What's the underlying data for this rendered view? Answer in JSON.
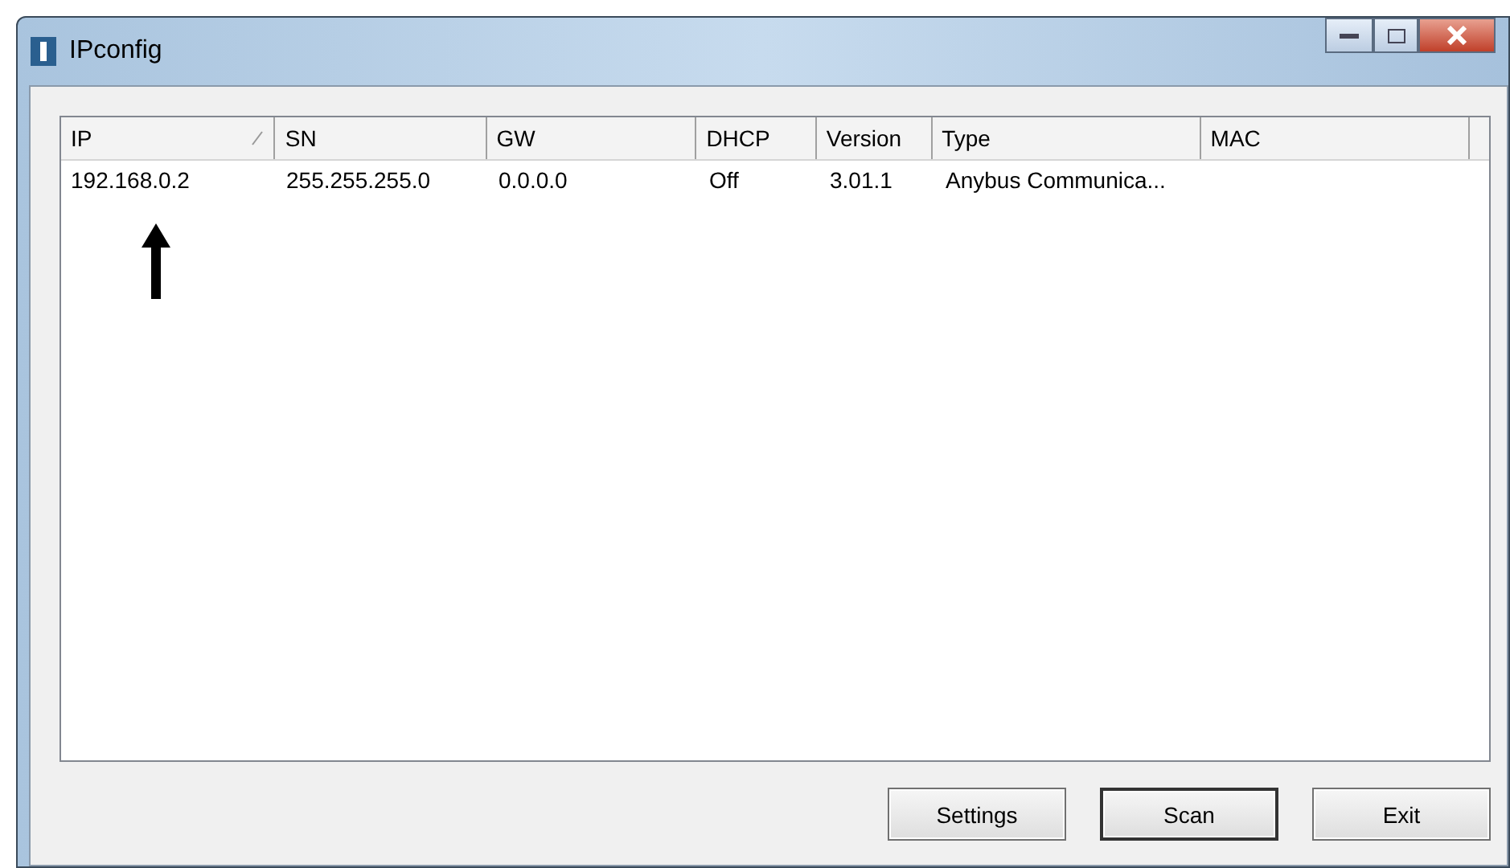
{
  "window": {
    "title": "IPconfig"
  },
  "table": {
    "columns": [
      {
        "label": "IP",
        "sorted": true
      },
      {
        "label": "SN",
        "sorted": false
      },
      {
        "label": "GW",
        "sorted": false
      },
      {
        "label": "DHCP",
        "sorted": false
      },
      {
        "label": "Version",
        "sorted": false
      },
      {
        "label": "Type",
        "sorted": false
      },
      {
        "label": "MAC",
        "sorted": false
      }
    ],
    "rows": [
      [
        "192.168.0.2",
        "255.255.255.0",
        "0.0.0.0",
        "Off",
        "3.01.1",
        "Anybus Communica...",
        ""
      ]
    ]
  },
  "buttons": [
    {
      "label": "Settings",
      "default": false
    },
    {
      "label": "Scan",
      "default": true
    },
    {
      "label": "Exit",
      "default": false
    }
  ]
}
